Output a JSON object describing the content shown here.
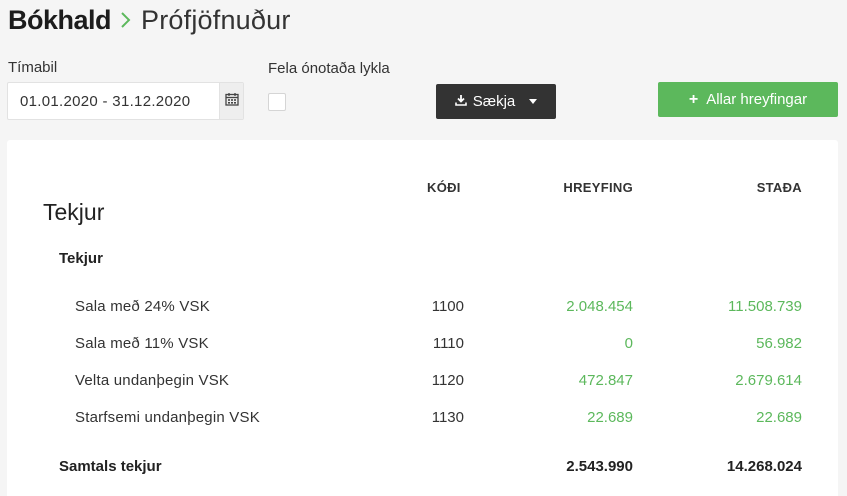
{
  "breadcrumb": {
    "root": "Bókhald",
    "current": "Prófjöfnuður"
  },
  "filters": {
    "period_label": "Tímabil",
    "date_range_value": "01.01.2020 - 31.12.2020",
    "hide_unused_label": "Fela ónotaða lykla",
    "hide_unused_checked": false,
    "fetch_button_label": "Sækja",
    "all_movements_button_label": "Allar hreyfingar"
  },
  "icons": {
    "calendar": "calendar-icon",
    "download": "download-icon",
    "plus": "plus-icon",
    "chevron": "chevron-right-icon"
  },
  "colors": {
    "accent_green": "#5cb85c",
    "dark_button": "#333333"
  },
  "report": {
    "columns": {
      "code": "KÓÐI",
      "movement": "HREYFING",
      "balance": "STAÐA"
    },
    "section_title": "Tekjur",
    "group_title": "Tekjur",
    "rows": [
      {
        "name": "Sala með 24% VSK",
        "code": "1100",
        "movement": "2.048.454",
        "balance": "11.508.739"
      },
      {
        "name": "Sala með 11% VSK",
        "code": "1110",
        "movement": "0",
        "balance": "56.982"
      },
      {
        "name": "Velta undanþegin VSK",
        "code": "1120",
        "movement": "472.847",
        "balance": "2.679.614"
      },
      {
        "name": "Starfsemi undanþegin VSK",
        "code": "1130",
        "movement": "22.689",
        "balance": "22.689"
      }
    ],
    "total": {
      "label": "Samtals tekjur",
      "movement": "2.543.990",
      "balance": "14.268.024"
    }
  }
}
